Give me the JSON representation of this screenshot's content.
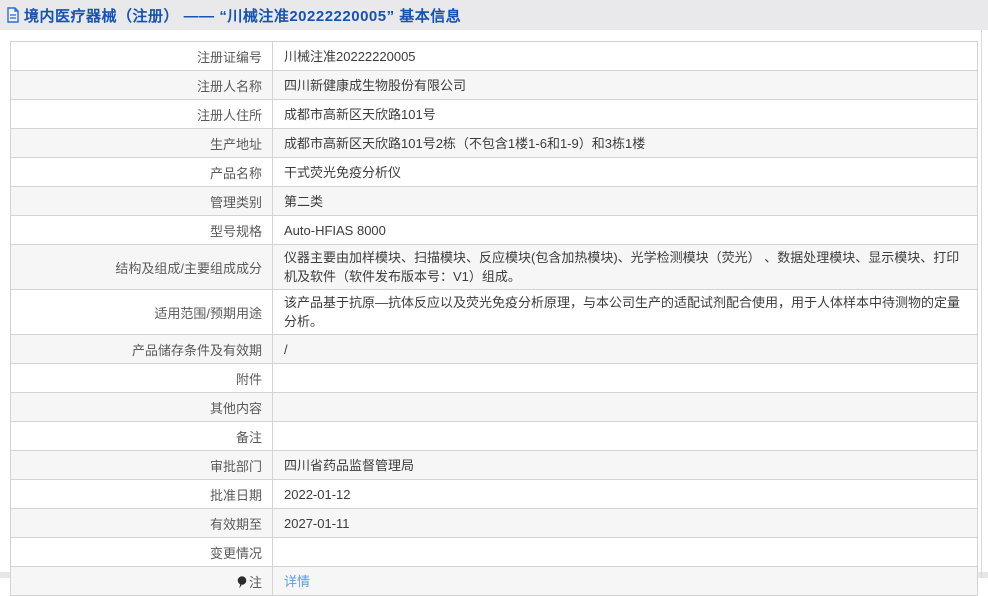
{
  "header": {
    "title": "境内医疗器械（注册） —— “川械注准20222220005” 基本信息",
    "icon": "document-icon"
  },
  "colors": {
    "band_bg": "#e9e9eb",
    "title_blue": "#1752ae",
    "link_blue": "#569df2",
    "row_alt_bg": "#f6f6f7",
    "border": "#d3d3d5"
  },
  "table": {
    "rows": [
      {
        "label": "注册证编号",
        "value": "川械注准20222220005"
      },
      {
        "label": "注册人名称",
        "value": "四川新健康成生物股份有限公司"
      },
      {
        "label": "注册人住所",
        "value": "成都市高新区天欣路101号"
      },
      {
        "label": "生产地址",
        "value": "成都市高新区天欣路101号2栋（不包含1楼1-6和1-9）和3栋1楼"
      },
      {
        "label": "产品名称",
        "value": "干式荧光免疫分析仪"
      },
      {
        "label": "管理类别",
        "value": "第二类"
      },
      {
        "label": "型号规格",
        "value": "Auto-HFIAS 8000"
      },
      {
        "label": "结构及组成/主要组成成分",
        "value": "仪器主要由加样模块、扫描模块、反应模块(包含加热模块)、光学检测模块（荧光） 、数据处理模块、显示模块、打印机及软件（软件发布版本号：V1）组成。",
        "tall": true
      },
      {
        "label": "适用范围/预期用途",
        "value": "该产品基于抗原—抗体反应以及荧光免疫分析原理，与本公司生产的适配试剂配合使用，用于人体样本中待测物的定量分析。"
      },
      {
        "label": "产品储存条件及有效期",
        "value": "/"
      },
      {
        "label": "附件",
        "value": ""
      },
      {
        "label": "其他内容",
        "value": ""
      },
      {
        "label": "备注",
        "value": ""
      },
      {
        "label": "审批部门",
        "value": "四川省药品监督管理局"
      },
      {
        "label": "批准日期",
        "value": "2022-01-12"
      },
      {
        "label": "有效期至",
        "value": "2027-01-11"
      },
      {
        "label": "变更情况",
        "value": ""
      },
      {
        "label": "注",
        "label_icon": "note-bulb-icon",
        "value": "详情",
        "link": true
      }
    ]
  }
}
